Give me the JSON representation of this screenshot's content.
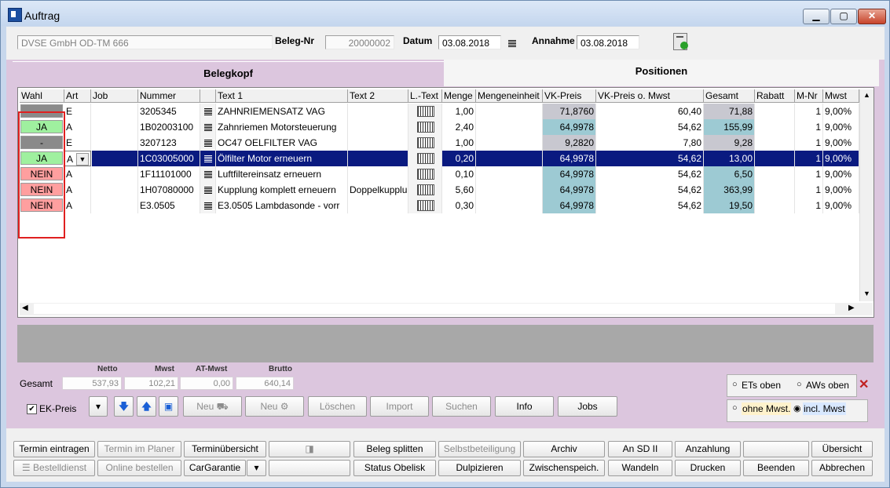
{
  "window": {
    "title": "Auftrag"
  },
  "header": {
    "customer": "DVSE GmbH OD-TM 666",
    "beleg_label": "Beleg-Nr",
    "beleg_value": "20000002",
    "datum_label": "Datum",
    "datum_value": "03.08.2018",
    "annahme_label": "Annahme",
    "annahme_value": "03.08.2018"
  },
  "tabs": [
    {
      "label": "Belegkopf"
    },
    {
      "label": "Positionen"
    }
  ],
  "table": {
    "headers": [
      "Wahl",
      "Art",
      "Job",
      "Nummer",
      "",
      "Text 1",
      "Text 2",
      "L.-Text",
      "Menge",
      "Mengeneinheit",
      "VK-Preis",
      "VK-Preis o. Mwst",
      "Gesamt",
      "Rabatt",
      "M-Nr",
      "Mwst"
    ],
    "rows": [
      {
        "wahl": "-",
        "art": "E",
        "job": "",
        "nummer": "3205345",
        "text1": "ZAHNRIEMENSATZ VAG",
        "text2": "",
        "menge": "1,00",
        "einheit": "",
        "vk": "71,8760",
        "vkomw": "60,40",
        "gesamt": "71,88",
        "rabatt": "",
        "mnr": "1",
        "mwst": "9,00%"
      },
      {
        "wahl": "JA",
        "art": "A",
        "job": "",
        "nummer": "1B02003100",
        "text1": "Zahnriemen Motorsteuerung",
        "text2": "",
        "menge": "2,40",
        "einheit": "",
        "vk": "64,9978",
        "vkomw": "54,62",
        "gesamt": "155,99",
        "rabatt": "",
        "mnr": "1",
        "mwst": "9,00%"
      },
      {
        "wahl": "-",
        "art": "E",
        "job": "",
        "nummer": "3207123",
        "text1": "OC47 OELFILTER VAG",
        "text2": "",
        "menge": "1,00",
        "einheit": "",
        "vk": "9,2820",
        "vkomw": "7,80",
        "gesamt": "9,28",
        "rabatt": "",
        "mnr": "1",
        "mwst": "9,00%"
      },
      {
        "wahl": "JA",
        "art": "A",
        "job": "",
        "nummer": "1C03005000",
        "text1": "Ölfilter Motor erneuern",
        "text2": "",
        "menge": "0,20",
        "einheit": "",
        "vk": "64,9978",
        "vkomw": "54,62",
        "gesamt": "13,00",
        "rabatt": "",
        "mnr": "1",
        "mwst": "9,00%"
      },
      {
        "wahl": "NEIN",
        "art": "A",
        "job": "",
        "nummer": "1F11101000",
        "text1": "Luftfiltereinsatz erneuern",
        "text2": "",
        "menge": "0,10",
        "einheit": "",
        "vk": "64,9978",
        "vkomw": "54,62",
        "gesamt": "6,50",
        "rabatt": "",
        "mnr": "1",
        "mwst": "9,00%"
      },
      {
        "wahl": "NEIN",
        "art": "A",
        "job": "",
        "nummer": "1H07080000",
        "text1": "Kupplung komplett erneuern",
        "text2": "Doppelkupplu",
        "menge": "5,60",
        "einheit": "",
        "vk": "64,9978",
        "vkomw": "54,62",
        "gesamt": "363,99",
        "rabatt": "",
        "mnr": "1",
        "mwst": "9,00%"
      },
      {
        "wahl": "NEIN",
        "art": "A",
        "job": "",
        "nummer": "E3.0505",
        "text1": "E3.0505 Lambdasonde - vorr",
        "text2": "",
        "menge": "0,30",
        "einheit": "",
        "vk": "64,9978",
        "vkomw": "54,62",
        "gesamt": "19,50",
        "rabatt": "",
        "mnr": "1",
        "mwst": "9,00%"
      }
    ],
    "selected_row": 3
  },
  "totals": {
    "row_label": "Gesamt",
    "netto_label": "Netto",
    "netto": "537,93",
    "mwst_label": "Mwst",
    "mwst": "102,21",
    "atmwst_label": "AT-Mwst",
    "atmwst": "0,00",
    "brutto_label": "Brutto",
    "brutto": "640,14"
  },
  "ekpreis": {
    "label": "EK-Preis",
    "checked": true
  },
  "toolbar": {
    "neu1": "Neu",
    "neu2": "Neu",
    "loeschen": "Löschen",
    "import": "Import",
    "suchen": "Suchen",
    "info": "Info",
    "jobs": "Jobs"
  },
  "radios": {
    "ets_oben": "ETs oben",
    "aws_oben": "AWs oben",
    "ohne_mwst": "ohne Mwst.",
    "incl_mwst": "incl. Mwst"
  },
  "bottom": {
    "termin_eintragen": "Termin eintragen",
    "termin_planer": "Termin im Planer",
    "terminuebersicht": "Terminübersicht",
    "beleg_splitten": "Beleg splitten",
    "selbstbeteiligung": "Selbstbeteiligung",
    "archiv": "Archiv",
    "an_sd": "An SD II",
    "anzahlung": "Anzahlung",
    "uebersicht": "Übersicht",
    "bestelldienst": "Bestelldienst",
    "online_bestellen": "Online bestellen",
    "cargarantie": "CarGarantie",
    "status_obelisk": "Status Obelisk",
    "duplizieren": "Dulpizieren",
    "zwischenspeich": "Zwischenspeich.",
    "wandeln": "Wandeln",
    "drucken": "Drucken",
    "beenden": "Beenden",
    "abbrechen": "Abbrechen"
  },
  "colors": {
    "ja": "#9ff09f",
    "nein": "#ff9f9f",
    "dash": "#8a8a8a",
    "vk_bg": "#9dcad3",
    "sel": "#0a1a80"
  }
}
